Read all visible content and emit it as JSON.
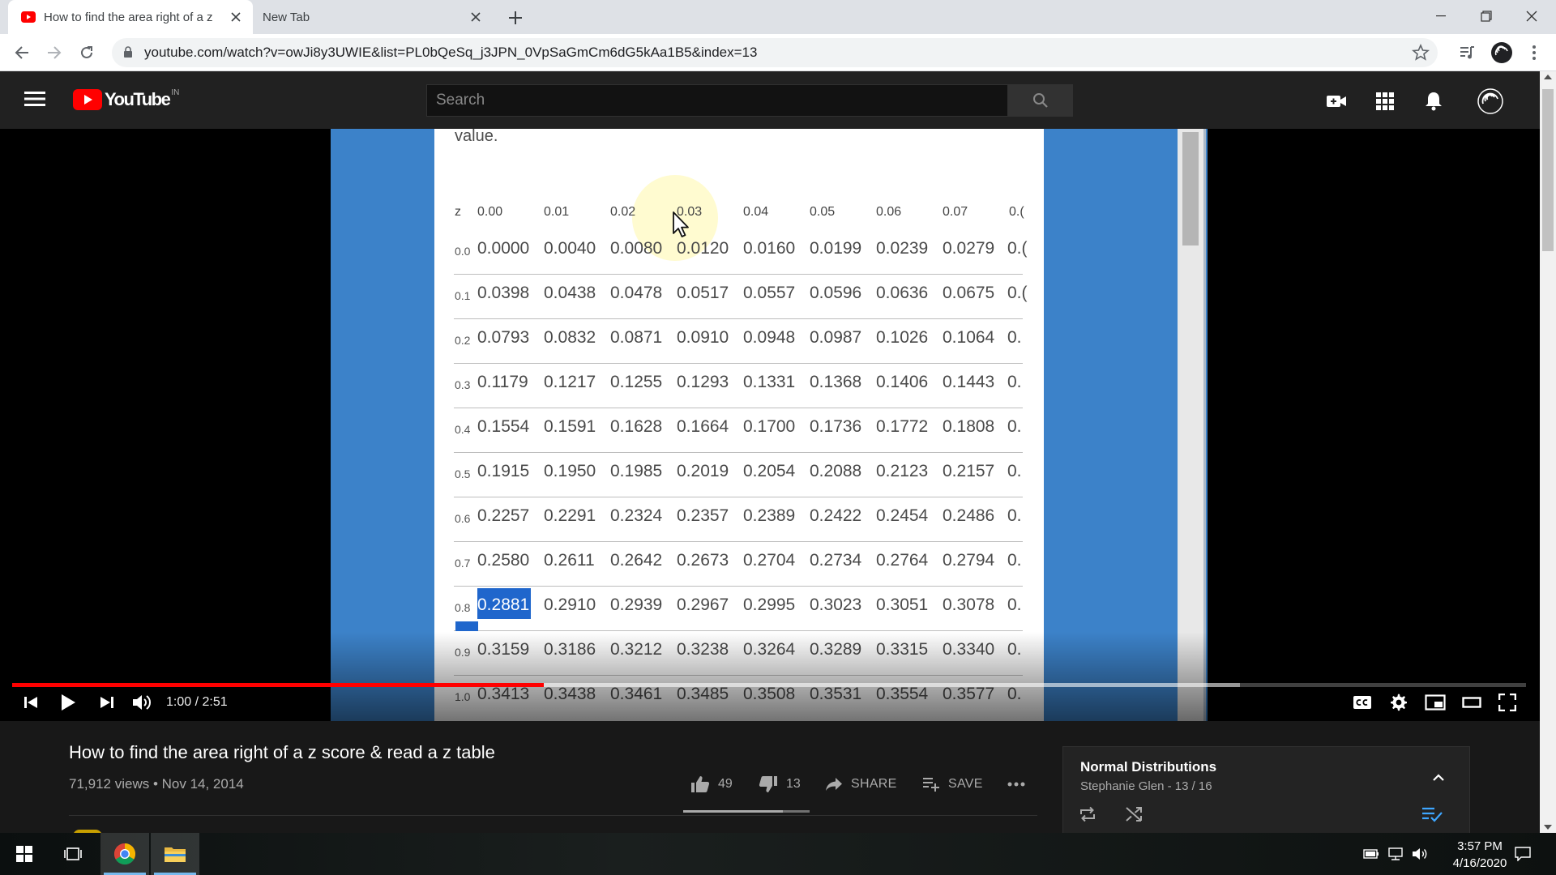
{
  "browser": {
    "tabs": [
      {
        "title": "How to find the area right of a z",
        "active": true,
        "favicon": "youtube-favicon"
      },
      {
        "title": "New Tab",
        "active": false
      }
    ],
    "url": "youtube.com/watch?v=owJi8y3UWIE&list=PL0bQeSq_j3JPN_0VpSaGmCm6dG5kAa1B5&index=13"
  },
  "youtube": {
    "logo_text": "YouTube",
    "region": "IN",
    "search_placeholder": "Search"
  },
  "video_frame": {
    "partial_text": "value.",
    "table": {
      "header": [
        "z",
        "0.00",
        "0.01",
        "0.02",
        "0.03",
        "0.04",
        "0.05",
        "0.06",
        "0.07",
        "0.("
      ],
      "rows": [
        {
          "z": "0.0",
          "cells": [
            "0.0000",
            "0.0040",
            "0.0080",
            "0.0120",
            "0.0160",
            "0.0199",
            "0.0239",
            "0.0279"
          ],
          "trail": "0.("
        },
        {
          "z": "0.1",
          "cells": [
            "0.0398",
            "0.0438",
            "0.0478",
            "0.0517",
            "0.0557",
            "0.0596",
            "0.0636",
            "0.0675"
          ],
          "trail": "0.("
        },
        {
          "z": "0.2",
          "cells": [
            "0.0793",
            "0.0832",
            "0.0871",
            "0.0910",
            "0.0948",
            "0.0987",
            "0.1026",
            "0.1064"
          ],
          "trail": "0."
        },
        {
          "z": "0.3",
          "cells": [
            "0.1179",
            "0.1217",
            "0.1255",
            "0.1293",
            "0.1331",
            "0.1368",
            "0.1406",
            "0.1443"
          ],
          "trail": "0."
        },
        {
          "z": "0.4",
          "cells": [
            "0.1554",
            "0.1591",
            "0.1628",
            "0.1664",
            "0.1700",
            "0.1736",
            "0.1772",
            "0.1808"
          ],
          "trail": "0."
        },
        {
          "z": "0.5",
          "cells": [
            "0.1915",
            "0.1950",
            "0.1985",
            "0.2019",
            "0.2054",
            "0.2088",
            "0.2123",
            "0.2157"
          ],
          "trail": "0."
        },
        {
          "z": "0.6",
          "cells": [
            "0.2257",
            "0.2291",
            "0.2324",
            "0.2357",
            "0.2389",
            "0.2422",
            "0.2454",
            "0.2486"
          ],
          "trail": "0."
        },
        {
          "z": "0.7",
          "cells": [
            "0.2580",
            "0.2611",
            "0.2642",
            "0.2673",
            "0.2704",
            "0.2734",
            "0.2764",
            "0.2794"
          ],
          "trail": "0."
        },
        {
          "z": "0.8",
          "cells": [
            "0.2881",
            "0.2910",
            "0.2939",
            "0.2967",
            "0.2995",
            "0.3023",
            "0.3051",
            "0.3078"
          ],
          "trail": "0."
        },
        {
          "z": "0.9",
          "cells": [
            "0.3159",
            "0.3186",
            "0.3212",
            "0.3238",
            "0.3264",
            "0.3289",
            "0.3315",
            "0.3340"
          ],
          "trail": "0."
        },
        {
          "z": "1.0",
          "cells": [
            "0.3413",
            "0.3438",
            "0.3461",
            "0.3485",
            "0.3508",
            "0.3531",
            "0.3554",
            "0.3577"
          ],
          "trail": "0."
        }
      ],
      "highlighted": "0.2881"
    }
  },
  "player": {
    "time": "1:00 / 2:51",
    "progress_fraction": 0.351,
    "buffered_fraction": 0.811
  },
  "video": {
    "title": "How to find the area right of a z score & read a z table",
    "meta": "71,912 views • Nov 14, 2014",
    "likes": "49",
    "dislikes": "13",
    "like_ratio": 0.79,
    "share_label": "SHARE",
    "save_label": "SAVE"
  },
  "playlist": {
    "title": "Normal Distributions",
    "subtitle": "Stephanie Glen - 13 / 16"
  },
  "taskbar": {
    "time": "3:57 PM",
    "date": "4/16/2020"
  },
  "colors": {
    "youtube_red": "#ff0000",
    "masthead": "#212121",
    "highlight_blue": "#1f66cc",
    "frame_blue": "#3c82c9"
  }
}
